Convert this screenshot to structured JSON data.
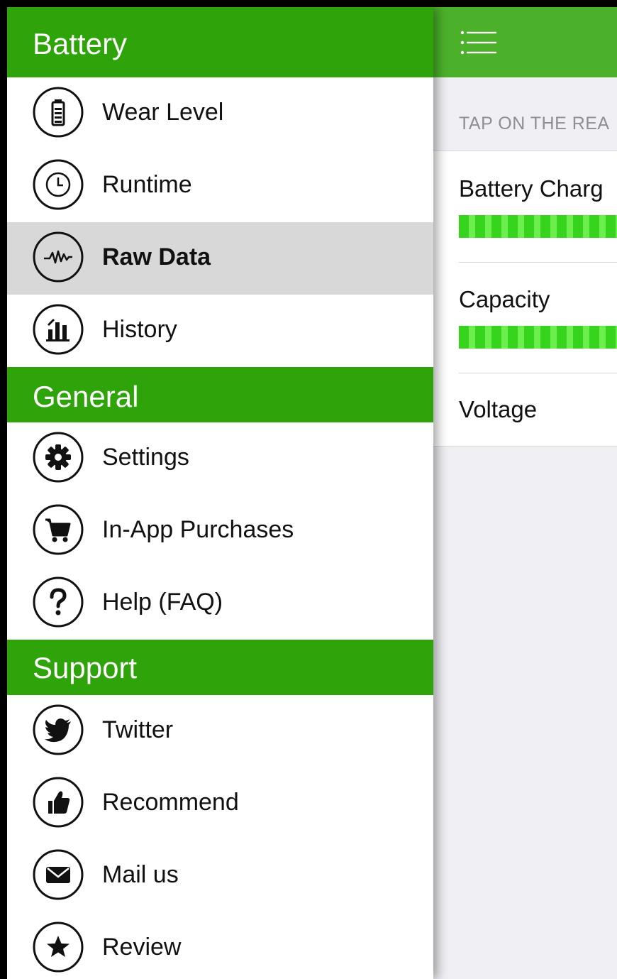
{
  "colors": {
    "header_green": "#2ea40a",
    "topbar_green": "#4cb12a",
    "bar_green": "#36d41c",
    "bar_green_light": "#6cee4c",
    "selected_bg": "#d8d8d8"
  },
  "main": {
    "caption": "TAP ON THE REA",
    "rows": [
      {
        "label": "Battery Charg"
      },
      {
        "label": "Capacity"
      },
      {
        "label": "Voltage"
      }
    ]
  },
  "drawer": {
    "sections": [
      {
        "title": "Battery",
        "items": [
          {
            "label": "Wear Level",
            "icon": "battery-icon"
          },
          {
            "label": "Runtime",
            "icon": "clock-icon"
          },
          {
            "label": "Raw Data",
            "icon": "pulse-icon",
            "selected": true
          },
          {
            "label": "History",
            "icon": "bar-chart-icon"
          }
        ]
      },
      {
        "title": "General",
        "items": [
          {
            "label": "Settings",
            "icon": "gear-icon"
          },
          {
            "label": "In-App Purchases",
            "icon": "cart-icon"
          },
          {
            "label": "Help (FAQ)",
            "icon": "question-icon"
          }
        ]
      },
      {
        "title": "Support",
        "items": [
          {
            "label": "Twitter",
            "icon": "twitter-icon"
          },
          {
            "label": "Recommend",
            "icon": "thumbs-up-icon"
          },
          {
            "label": "Mail us",
            "icon": "mail-icon"
          },
          {
            "label": "Review",
            "icon": "star-icon"
          }
        ]
      }
    ]
  }
}
